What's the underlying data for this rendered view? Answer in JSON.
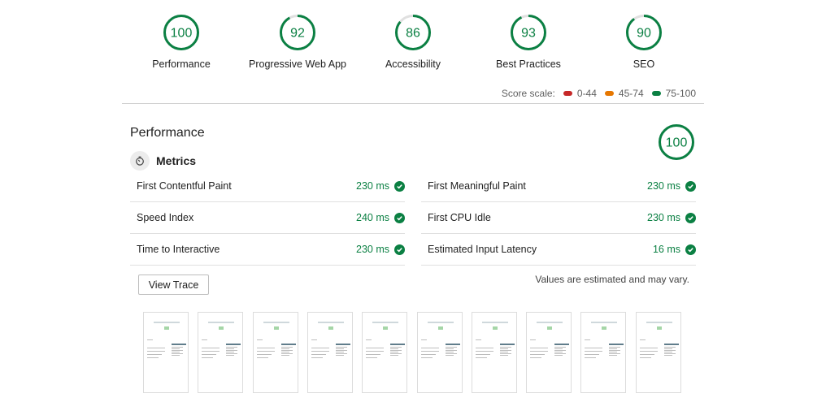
{
  "gauges": [
    {
      "label": "Performance",
      "score": "100",
      "value": 100
    },
    {
      "label": "Progressive Web App",
      "score": "92",
      "value": 92
    },
    {
      "label": "Accessibility",
      "score": "86",
      "value": 86
    },
    {
      "label": "Best Practices",
      "score": "93",
      "value": 93
    },
    {
      "label": "SEO",
      "score": "90",
      "value": 90
    }
  ],
  "scale": {
    "label": "Score scale:",
    "ranges": [
      {
        "text": "0-44",
        "color": "#c62828"
      },
      {
        "text": "45-74",
        "color": "#e67700"
      },
      {
        "text": "75-100",
        "color": "#0b8043"
      }
    ]
  },
  "performance": {
    "title": "Performance",
    "score": "100",
    "value": 100,
    "metrics_label": "Metrics",
    "metrics_left": [
      {
        "name": "First Contentful Paint",
        "value": "230 ms"
      },
      {
        "name": "Speed Index",
        "value": "240 ms"
      },
      {
        "name": "Time to Interactive",
        "value": "230 ms"
      }
    ],
    "metrics_right": [
      {
        "name": "First Meaningful Paint",
        "value": "230 ms"
      },
      {
        "name": "First CPU Idle",
        "value": "230 ms"
      },
      {
        "name": "Estimated Input Latency",
        "value": "16 ms"
      }
    ],
    "view_trace_label": "View Trace",
    "note": "Values are estimated and may vary."
  },
  "filmstrip": {
    "frame_count": 10
  },
  "colors": {
    "pass": "#0b8043",
    "track": "#e0e0e0"
  }
}
